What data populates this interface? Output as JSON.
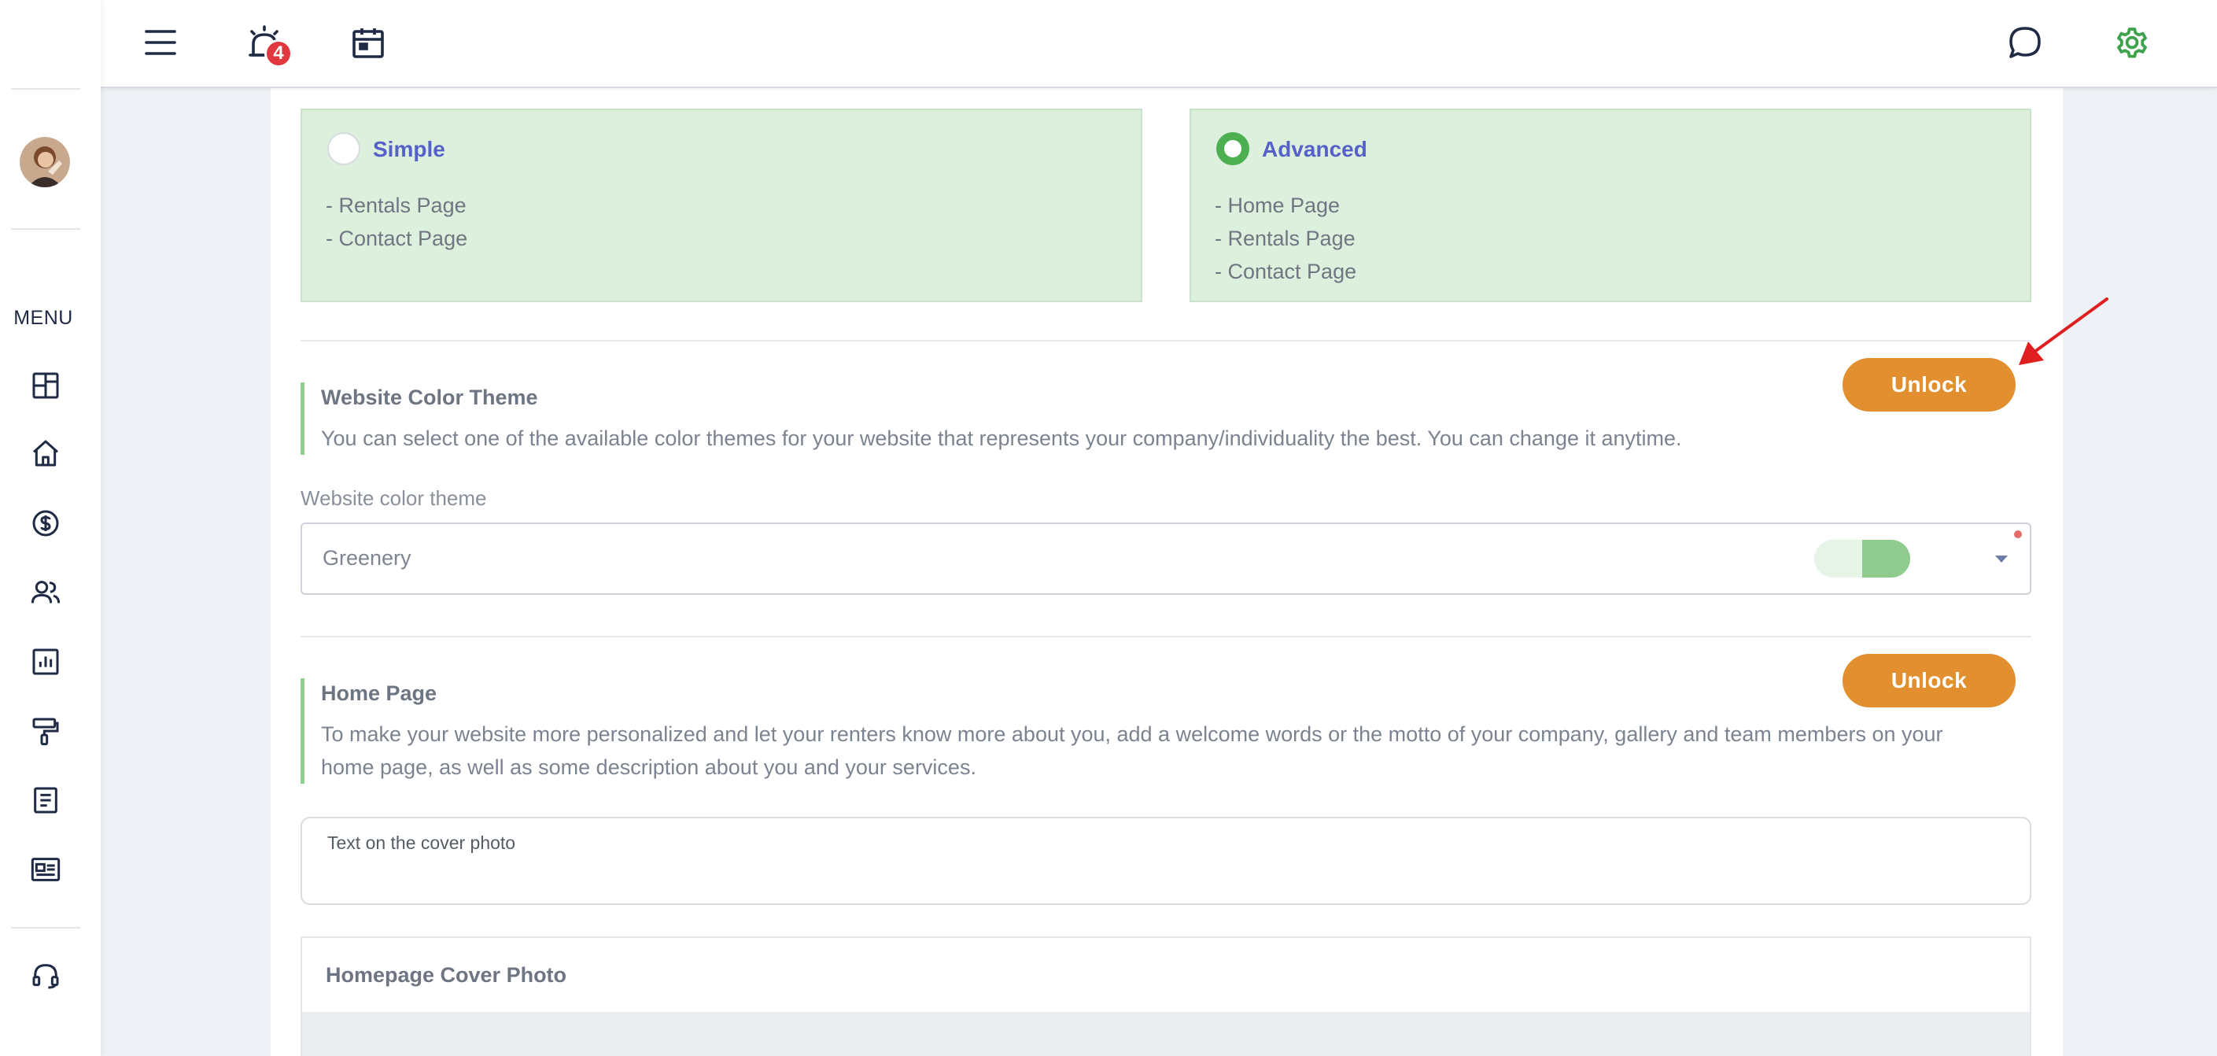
{
  "sidebar": {
    "menu_label": "MENU",
    "icons": [
      "dashboard-icon",
      "home-icon",
      "dollar-icon",
      "users-icon",
      "report-icon",
      "paint-roller-icon",
      "document-icon",
      "id-card-icon",
      "headset-icon"
    ]
  },
  "topbar": {
    "notification_count": "4",
    "icons": [
      "hamburger-menu-icon",
      "alarm-icon",
      "calendar-icon",
      "chat-icon",
      "gear-icon"
    ]
  },
  "plans": [
    {
      "name": "Simple",
      "selected": false,
      "pages": [
        "- Rentals Page",
        "- Contact Page"
      ]
    },
    {
      "name": "Advanced",
      "selected": true,
      "pages": [
        "- Home Page",
        "- Rentals Page",
        "- Contact Page"
      ]
    }
  ],
  "color_theme_section": {
    "title": "Website Color Theme",
    "description": "You can select one of the available color themes for your website that represents your company/individuality the best. You can change it anytime.",
    "unlock_label": "Unlock",
    "field_label": "Website color theme",
    "selected_theme": "Greenery",
    "swatch_colors": [
      "#e6f4e7",
      "#8fcb8f"
    ]
  },
  "home_page_section": {
    "title": "Home Page",
    "description_line1": "To make your website more personalized and let your renters know more about you, add a welcome words or the motto of your company, gallery and team members on your",
    "description_line2": "home page, as well as some description about you and your services.",
    "unlock_label": "Unlock",
    "cover_text_label": "Text on the cover photo",
    "cover_photo_title": "Homepage Cover Photo"
  },
  "colors": {
    "accent_orange": "#e2902f",
    "plan_bg": "#dcf0dd",
    "section_bar": "#8fcf92",
    "link_blue": "#5561c9",
    "settings_green": "#3fa34d"
  }
}
